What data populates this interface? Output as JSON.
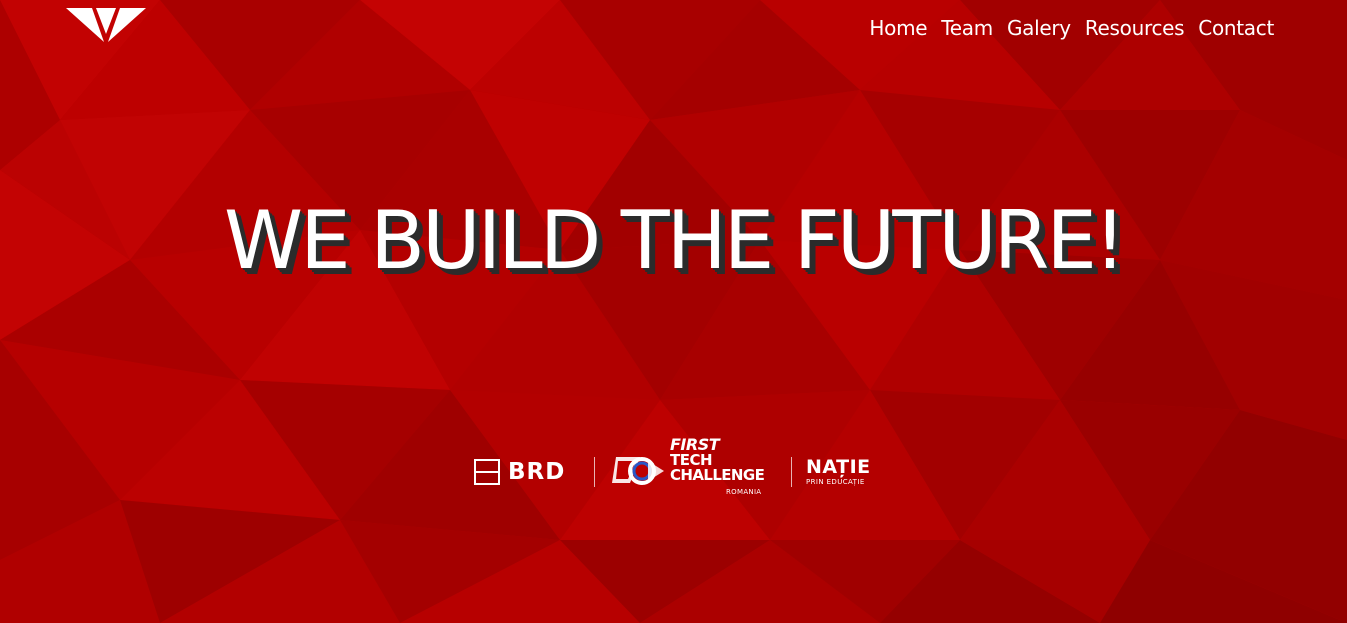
{
  "nav": {
    "items": [
      {
        "label": "Home"
      },
      {
        "label": "Team"
      },
      {
        "label": "Galery"
      },
      {
        "label": "Resources"
      },
      {
        "label": "Contact"
      }
    ]
  },
  "hero": {
    "headline": "WE BUILD THE FUTURE!"
  },
  "sponsors": {
    "brd": "BRD",
    "ftc_first": "FIRST",
    "ftc_tech": "TECH",
    "ftc_challenge": "CHALLENGE",
    "ftc_romania": "ROMANIA",
    "natie_title": "NAȚIE",
    "natie_sub": "PRIN EDUCAȚIE"
  },
  "colors": {
    "background": "#b80000",
    "text": "#ffffff",
    "headline_shadow": "#2b2b2b"
  },
  "icons": {
    "logo": "team-triangle-logo",
    "ftc": "ftc-logo"
  }
}
